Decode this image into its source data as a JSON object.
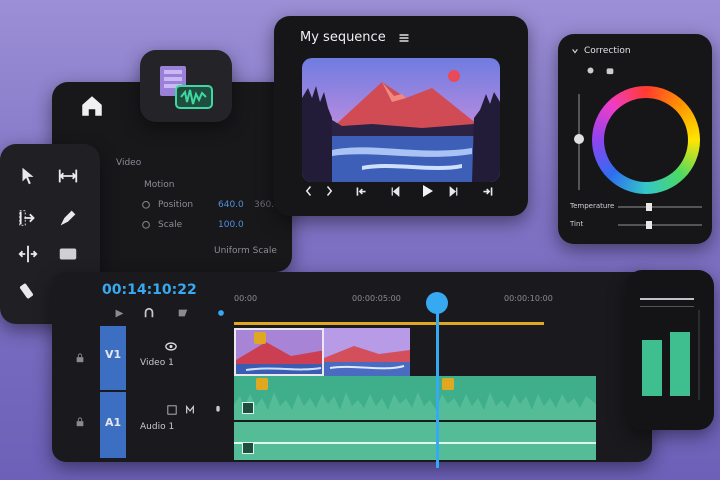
{
  "preview": {
    "title": "My sequence",
    "menu_icon": "hamburger-icon",
    "controls": [
      "mark-in-icon",
      "mark-out-icon",
      "go-to-in-icon",
      "step-back-icon",
      "play-icon",
      "step-forward-icon",
      "go-to-out-icon"
    ]
  },
  "color_panel": {
    "title": "Correction",
    "temperature_label": "Temperature",
    "tint_label": "Tint"
  },
  "effects": {
    "section": "Video",
    "motion": "Motion",
    "position_label": "Position",
    "position_x": "640.0",
    "position_y": "360.0",
    "scale_label": "Scale",
    "scale_value": "100.0",
    "uniform_scale": "Uniform Scale"
  },
  "timeline": {
    "timecode": "00:14:10:22",
    "ruler": [
      "00:00",
      "00:00:05:00",
      "00:00:10:00"
    ],
    "tracks": [
      {
        "id": "V1",
        "name": "Video 1"
      },
      {
        "id": "A1",
        "name": "Audio 1"
      }
    ]
  },
  "colors": {
    "accent_blue": "#37a9f0",
    "audio_green": "#3fae8a",
    "clip_yellow": "#e0a820",
    "meter_green": "#3fbf8f"
  }
}
